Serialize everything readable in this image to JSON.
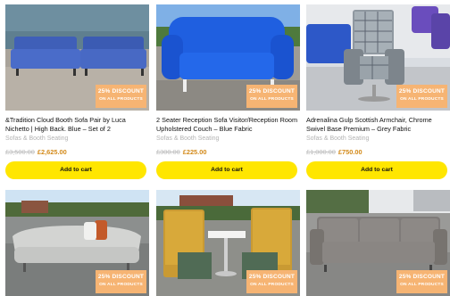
{
  "products": [
    {
      "badge_line1": "25% DISCOUNT",
      "badge_line2": "ON ALL PRODUCTS",
      "title": "&Tradition Cloud Booth Sofa Pair by Luca Nichetto | High Back. Blue – Set of 2",
      "category": "Sofas & Booth Seating",
      "old_price": "£3,500.00",
      "new_price": "£2,625.00",
      "button": "Add to cart",
      "image_icon": "blue-booth-sofa-pair-photo"
    },
    {
      "badge_line1": "25% DISCOUNT",
      "badge_line2": "ON ALL PRODUCTS",
      "title": "2 Seater Reception Sofa Visitor/Reception Room Upholstered Couch – Blue Fabric",
      "category": "Sofas & Booth Seating",
      "old_price": "£300.00",
      "new_price": "£225.00",
      "button": "Add to cart",
      "image_icon": "blue-two-seater-sofa-photo"
    },
    {
      "badge_line1": "25% DISCOUNT",
      "badge_line2": "ON ALL PRODUCTS",
      "title": "Adrenalina Gulp Scottish Armchair, Chrome Swivel Base Premium – Grey Fabric",
      "category": "Sofas & Booth Seating",
      "old_price": "£1,000.00",
      "new_price": "£750.00",
      "button": "Add to cart",
      "image_icon": "grey-check-armchair-photo"
    },
    {
      "badge_line1": "25% DISCOUNT",
      "badge_line2": "ON ALL PRODUCTS",
      "image_icon": "grey-curved-sofa-photo"
    },
    {
      "badge_line1": "25% DISCOUNT",
      "badge_line2": "ON ALL PRODUCTS",
      "image_icon": "mustard-booth-seating-photo"
    },
    {
      "badge_line1": "25% DISCOUNT",
      "badge_line2": "ON ALL PRODUCTS",
      "image_icon": "grey-three-seater-sofa-photo"
    }
  ],
  "colors": {
    "badge": "#f6b473",
    "button": "#ffe600",
    "new_price": "#d38a1a",
    "old_price": "#bdbdbd",
    "category": "#b4b4b4"
  }
}
